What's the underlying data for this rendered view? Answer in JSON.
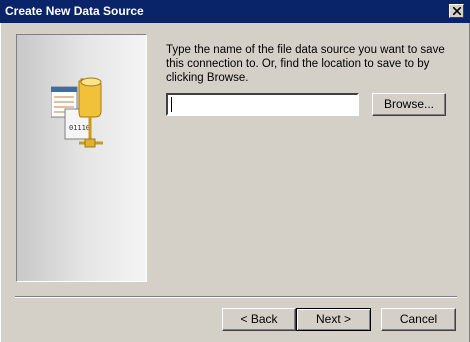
{
  "window": {
    "title": "Create New Data Source",
    "close_icon": "close-icon"
  },
  "main": {
    "illustration_icon": "data-source-icon",
    "instructions": "Type the name of the file data source you want to save this connection to.  Or, find the location to save to by clicking Browse.",
    "file_name_value": "",
    "browse_label": "Browse..."
  },
  "footer": {
    "back_label": "< Back",
    "next_label": "Next >",
    "cancel_label": "Cancel"
  },
  "colors": {
    "titlebar": "#0a246a",
    "dialog_bg": "#d4d0c8"
  }
}
